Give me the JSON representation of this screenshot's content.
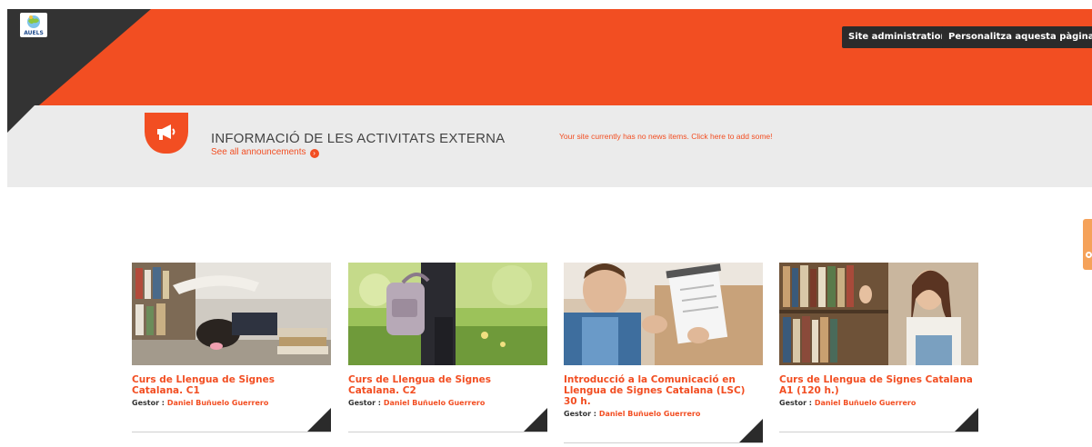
{
  "brand": {
    "logo_text": "AUELS"
  },
  "header": {
    "admin_button": "Site administration",
    "customize_button": "Personalitza aquesta pàgina"
  },
  "news": {
    "title": "INFORMACIÓ DE LES ACTIVITATS EXTERNA",
    "see_all": "See all announcements",
    "empty_message": "Your site currently has no news items. Click here to add some!"
  },
  "courses": [
    {
      "title": "Curs de Llengua de Signes Catalana. C1",
      "gestor_label": "Gestor :",
      "gestor_name": "Daniel Buñuelo Guerrero"
    },
    {
      "title": "Curs de Llengua de Signes Catalana. C2",
      "gestor_label": "Gestor :",
      "gestor_name": "Daniel Buñuelo Guerrero"
    },
    {
      "title": "Introducció a la Comunicació en Llengua de Signes Catalana (LSC) 30 h.",
      "gestor_label": "Gestor :",
      "gestor_name": "Daniel Buñuelo Guerrero"
    },
    {
      "title": "Curs de Llengua de Signes Catalana A1 (120 h.)",
      "gestor_label": "Gestor :",
      "gestor_name": "Daniel Buñuelo Guerrero"
    }
  ],
  "colors": {
    "accent": "#f24e22",
    "dark": "#333333",
    "band": "#ebebeb"
  },
  "icons": {
    "announcement": "megaphone-icon",
    "see_all_arrow": "chevron-right-circle-icon"
  }
}
